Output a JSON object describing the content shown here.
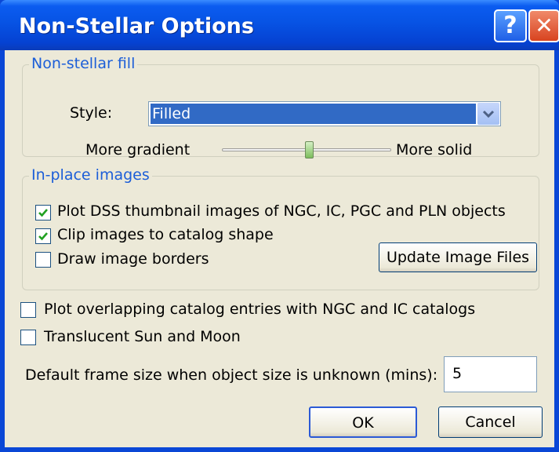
{
  "window": {
    "title": "Non-Stellar Options",
    "help_glyph": "?",
    "close_glyph": "✕"
  },
  "fill": {
    "legend": "Non-stellar fill",
    "style_label": "Style:",
    "style_value": "Filled",
    "gradient_label": "More gradient",
    "solid_label": "More solid",
    "slider_level": 0.5
  },
  "images": {
    "legend": "In-place images",
    "plot_dss": {
      "label": "Plot DSS thumbnail images of NGC, IC, PGC and PLN objects",
      "checked": true
    },
    "clip": {
      "label": "Clip images to catalog shape",
      "checked": true
    },
    "borders": {
      "label": "Draw image borders",
      "checked": false
    },
    "update_button": "Update Image Files"
  },
  "overlapping": {
    "label": "Plot overlapping catalog entries with NGC and IC catalogs",
    "checked": false
  },
  "translucent": {
    "label": "Translucent Sun and Moon",
    "checked": false
  },
  "frame": {
    "label": "Default frame size when object size is unknown (mins):",
    "value": "5"
  },
  "buttons": {
    "ok": "OK",
    "cancel": "Cancel"
  }
}
